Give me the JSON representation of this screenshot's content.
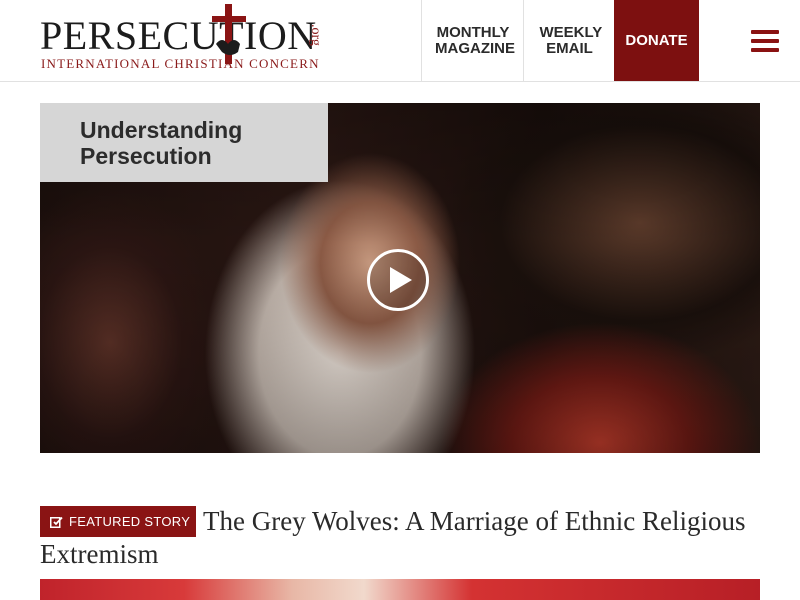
{
  "header": {
    "logo": {
      "wordmark": "PERSECUTION",
      "domain": ".org",
      "tagline": "INTERNATIONAL CHRISTIAN CONCERN"
    },
    "nav": {
      "magazine_label": "MONTHLY MAGAZINE",
      "email_label": "WEEKLY EMAIL",
      "donate_label": "DONATE"
    },
    "menu_icon": "hamburger-icon"
  },
  "hero": {
    "label": "Understanding Persecution",
    "play_icon": "play-icon"
  },
  "featured": {
    "badge_label": "FEATURED STORY",
    "badge_icon": "edit-icon",
    "title": "The Grey Wolves: A Marriage of Ethnic Religious Extremism"
  },
  "colors": {
    "brand_red": "#7d1010",
    "badge_red": "#8a1414",
    "label_gray": "#d6d6d6"
  }
}
